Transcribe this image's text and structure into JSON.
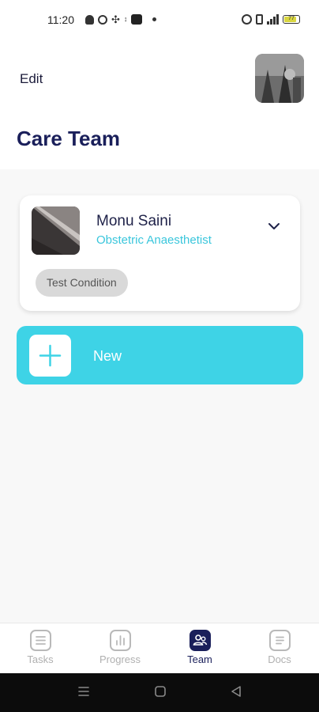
{
  "status_bar": {
    "time": "11:20",
    "left_icons": [
      "snapchat-icon",
      "globe-icon",
      "slack-icon",
      "data-icon",
      "app-icon"
    ],
    "battery_level": "77",
    "signal": "4G"
  },
  "header": {
    "edit_label": "Edit",
    "title": "Care Team"
  },
  "team": {
    "members": [
      {
        "name": "Monu Saini",
        "role": "Obstetric Anaesthetist",
        "condition": "Test Condition"
      }
    ],
    "new_label": "New"
  },
  "bottom_nav": {
    "items": [
      {
        "label": "Tasks",
        "icon": "list-icon",
        "active": false
      },
      {
        "label": "Progress",
        "icon": "bar-chart-icon",
        "active": false
      },
      {
        "label": "Team",
        "icon": "team-icon",
        "active": true
      },
      {
        "label": "Docs",
        "icon": "document-icon",
        "active": false
      }
    ]
  },
  "colors": {
    "accent": "#3ed3e6",
    "brand_navy": "#1a1f5a",
    "role_text": "#3ac6dc"
  }
}
